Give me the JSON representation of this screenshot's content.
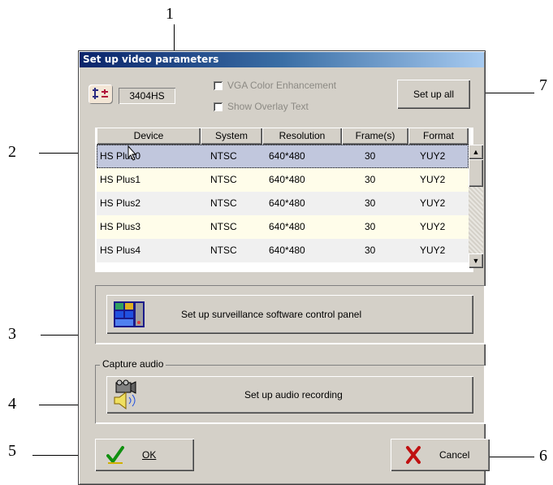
{
  "callouts": {
    "n1": "1",
    "n2": "2",
    "n3": "3",
    "n4": "4",
    "n5": "5",
    "n6": "6",
    "n7": "7"
  },
  "dialog": {
    "title": "Set up video parameters",
    "model": "3404HS",
    "vga_color_enhancement": "VGA Color Enhancement",
    "show_overlay_text": "Show Overlay Text",
    "setup_all": "Set up all",
    "table": {
      "headers": [
        "Device",
        "System",
        "Resolution",
        "Frame(s)",
        "Format"
      ],
      "rows": [
        {
          "device": "HS Plus0",
          "system": "NTSC",
          "resolution": "640*480",
          "frames": "30",
          "format": "YUY2",
          "selected": true
        },
        {
          "device": "HS Plus1",
          "system": "NTSC",
          "resolution": "640*480",
          "frames": "30",
          "format": "YUY2",
          "selected": false
        },
        {
          "device": "HS Plus2",
          "system": "NTSC",
          "resolution": "640*480",
          "frames": "30",
          "format": "YUY2",
          "selected": false
        },
        {
          "device": "HS Plus3",
          "system": "NTSC",
          "resolution": "640*480",
          "frames": "30",
          "format": "YUY2",
          "selected": false
        },
        {
          "device": "HS Plus4",
          "system": "NTSC",
          "resolution": "640*480",
          "frames": "30",
          "format": "YUY2",
          "selected": false
        }
      ]
    },
    "control_panel_button": "Set up surveillance software control panel",
    "capture_audio_label": "Capture audio",
    "audio_button": "Set up audio recording",
    "ok": "OK",
    "cancel": "Cancel"
  },
  "colors": {
    "selected_row": "#c1c7dd",
    "row_yellow": "#fffdea",
    "row_gray": "#f0f0f0",
    "row_white": "#ffffff"
  },
  "icons": [
    "device-settings-icon",
    "scroll-up-icon",
    "scroll-down-icon",
    "control-panel-icon",
    "audio-recording-icon",
    "checkmark-icon",
    "cancel-x-icon",
    "mouse-cursor-icon"
  ]
}
